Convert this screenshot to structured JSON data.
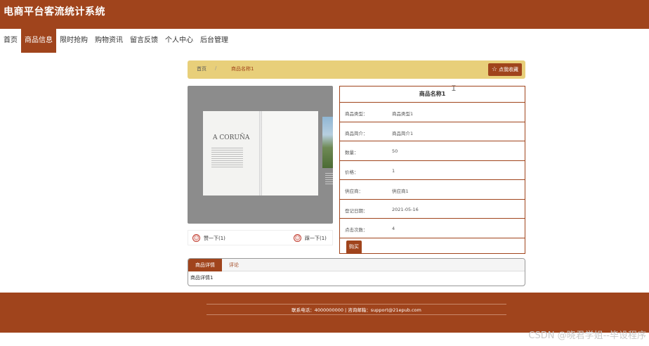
{
  "header": {
    "title": "电商平台客流统计系统"
  },
  "nav": {
    "items": [
      {
        "label": "首页"
      },
      {
        "label": "商品信息"
      },
      {
        "label": "限时抢购"
      },
      {
        "label": "购物资讯"
      },
      {
        "label": "留言反馈"
      },
      {
        "label": "个人中心"
      },
      {
        "label": "后台管理"
      }
    ],
    "active": "商品信息"
  },
  "breadcrumb": {
    "home": "首页",
    "separator": "/",
    "current": "商品名称1"
  },
  "favorite": {
    "label": "点我收藏",
    "icon": "star-outline-icon"
  },
  "product": {
    "image_brand_text": "A CORUÑA",
    "title": "商品名称1",
    "fields": [
      {
        "key": "商品类型：",
        "value": "商品类型1"
      },
      {
        "key": "商品简介：",
        "value": "商品简介1"
      },
      {
        "key": "数量：",
        "value": "50"
      },
      {
        "key": "价格：",
        "value": "1"
      },
      {
        "key": "供应商：",
        "value": "供应商1"
      },
      {
        "key": "登记日期：",
        "value": "2021-05-16"
      },
      {
        "key": "点击次数：",
        "value": "4"
      }
    ],
    "buy_label": "购买"
  },
  "votes": {
    "up_label": "赞一下(1)",
    "down_label": "踩一下(1)"
  },
  "tabs": {
    "items": [
      {
        "label": "商品详情"
      },
      {
        "label": "评论"
      }
    ],
    "active": "商品详情",
    "content": "商品详情1"
  },
  "footer": {
    "text": "联系电话：4000000000 | 咨询邮箱：support@21epub.com"
  },
  "watermark": "CSDN @晓君学姐--毕设程序",
  "colors": {
    "primary": "#a0441c",
    "breadcrumb_bg": "#e8cf7a"
  }
}
